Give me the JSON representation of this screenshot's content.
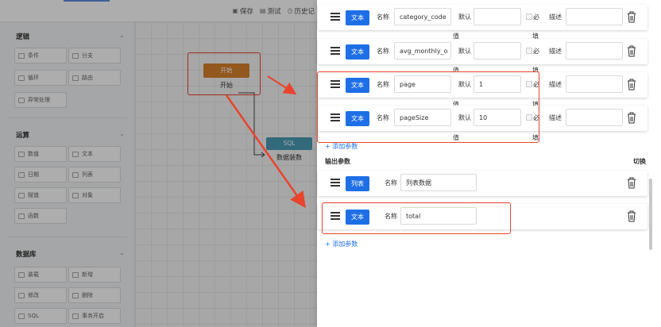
{
  "toolbar": {
    "save": "保存",
    "test": "测试",
    "history": "历史记"
  },
  "palette": {
    "sections": [
      {
        "title": "逻辑",
        "items": [
          "条件",
          "分支",
          "循环",
          "路由",
          "异常处理"
        ]
      },
      {
        "title": "运算",
        "items": [
          "数值",
          "文本",
          "日期",
          "列表",
          "赋值",
          "对象",
          "函数"
        ]
      },
      {
        "title": "数据库",
        "items": [
          "装载",
          "新增",
          "修改",
          "删除",
          "SQL",
          "事务开启"
        ]
      }
    ]
  },
  "canvas": {
    "start_node": "开始",
    "start_caption": "开始",
    "sql_node": "SQL",
    "sql_caption": "数据装数"
  },
  "input_params": {
    "labels": {
      "name": "名称",
      "default": "默认",
      "default_wrap": "值",
      "required": "必",
      "required_wrap": "填",
      "desc": "描述"
    },
    "rows": [
      {
        "type": "文本",
        "name": "category_code",
        "default": ""
      },
      {
        "type": "文本",
        "name": "avg_monthly_o",
        "default": ""
      },
      {
        "type": "文本",
        "name": "page",
        "default": "1"
      },
      {
        "type": "文本",
        "name": "pageSize",
        "default": "10"
      }
    ],
    "add": "+ 添加参数"
  },
  "output_params": {
    "title": "输出参数",
    "switch": "切换",
    "rows": [
      {
        "type": "列表",
        "name": "列表数据"
      },
      {
        "type": "文本",
        "name": "total"
      }
    ],
    "add": "+ 添加参数"
  },
  "colors": {
    "accent": "#1e6fe6",
    "annotation": "#e8442e",
    "start_node": "#d9822b",
    "sql_node": "#4a9bb5"
  }
}
